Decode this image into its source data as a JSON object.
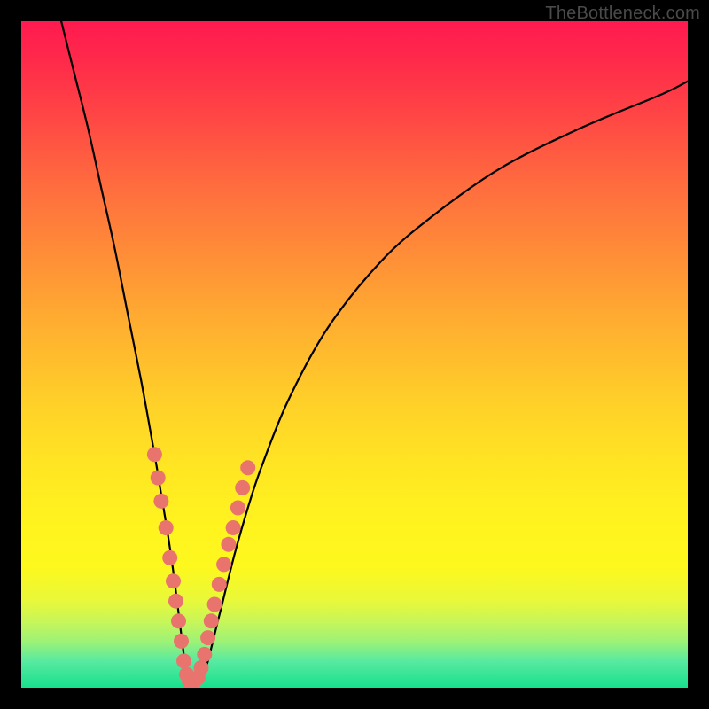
{
  "watermark": "TheBottleneck.com",
  "colors": {
    "frame": "#000000",
    "curve_stroke": "#000000",
    "marker_fill": "#e9746e",
    "gradient_top": "#ff1a50",
    "gradient_bottom": "#17e08d"
  },
  "chart_data": {
    "type": "line",
    "title": "",
    "xlabel": "",
    "ylabel": "",
    "xlim": [
      0,
      100
    ],
    "ylim": [
      0,
      100
    ],
    "grid": false,
    "legend": false,
    "note": "V-shaped bottleneck curve on vertical gradient; no axis ticks shown. Values are estimated pixel-derived percentages of plot area (x left→right, y bottom→top).",
    "series": [
      {
        "name": "bottleneck-curve",
        "x": [
          6,
          8,
          10,
          12,
          14,
          16,
          18,
          20,
          21,
          22,
          23,
          24,
          25,
          26,
          27,
          28,
          29,
          30,
          32,
          34,
          36,
          40,
          46,
          54,
          62,
          72,
          84,
          96,
          100
        ],
        "y": [
          100,
          92,
          84,
          75,
          66,
          56,
          46,
          35,
          29,
          23,
          16,
          8,
          1,
          1,
          1,
          4,
          8,
          12,
          20,
          27,
          33,
          43,
          54,
          64,
          71,
          78,
          84,
          89,
          91
        ]
      }
    ],
    "markers": [
      {
        "x": 20.0,
        "y": 35.0
      },
      {
        "x": 20.5,
        "y": 31.5
      },
      {
        "x": 21.0,
        "y": 28.0
      },
      {
        "x": 21.7,
        "y": 24.0
      },
      {
        "x": 22.3,
        "y": 19.5
      },
      {
        "x": 22.8,
        "y": 16.0
      },
      {
        "x": 23.2,
        "y": 13.0
      },
      {
        "x": 23.6,
        "y": 10.0
      },
      {
        "x": 24.0,
        "y": 7.0
      },
      {
        "x": 24.4,
        "y": 4.0
      },
      {
        "x": 24.8,
        "y": 2.0
      },
      {
        "x": 25.2,
        "y": 1.0
      },
      {
        "x": 25.6,
        "y": 1.0
      },
      {
        "x": 26.0,
        "y": 1.0
      },
      {
        "x": 26.5,
        "y": 1.5
      },
      {
        "x": 27.0,
        "y": 3.0
      },
      {
        "x": 27.5,
        "y": 5.0
      },
      {
        "x": 28.0,
        "y": 7.5
      },
      {
        "x": 28.5,
        "y": 10.0
      },
      {
        "x": 29.0,
        "y": 12.5
      },
      {
        "x": 29.7,
        "y": 15.5
      },
      {
        "x": 30.4,
        "y": 18.5
      },
      {
        "x": 31.1,
        "y": 21.5
      },
      {
        "x": 31.8,
        "y": 24.0
      },
      {
        "x": 32.5,
        "y": 27.0
      },
      {
        "x": 33.2,
        "y": 30.0
      },
      {
        "x": 34.0,
        "y": 33.0
      }
    ]
  }
}
